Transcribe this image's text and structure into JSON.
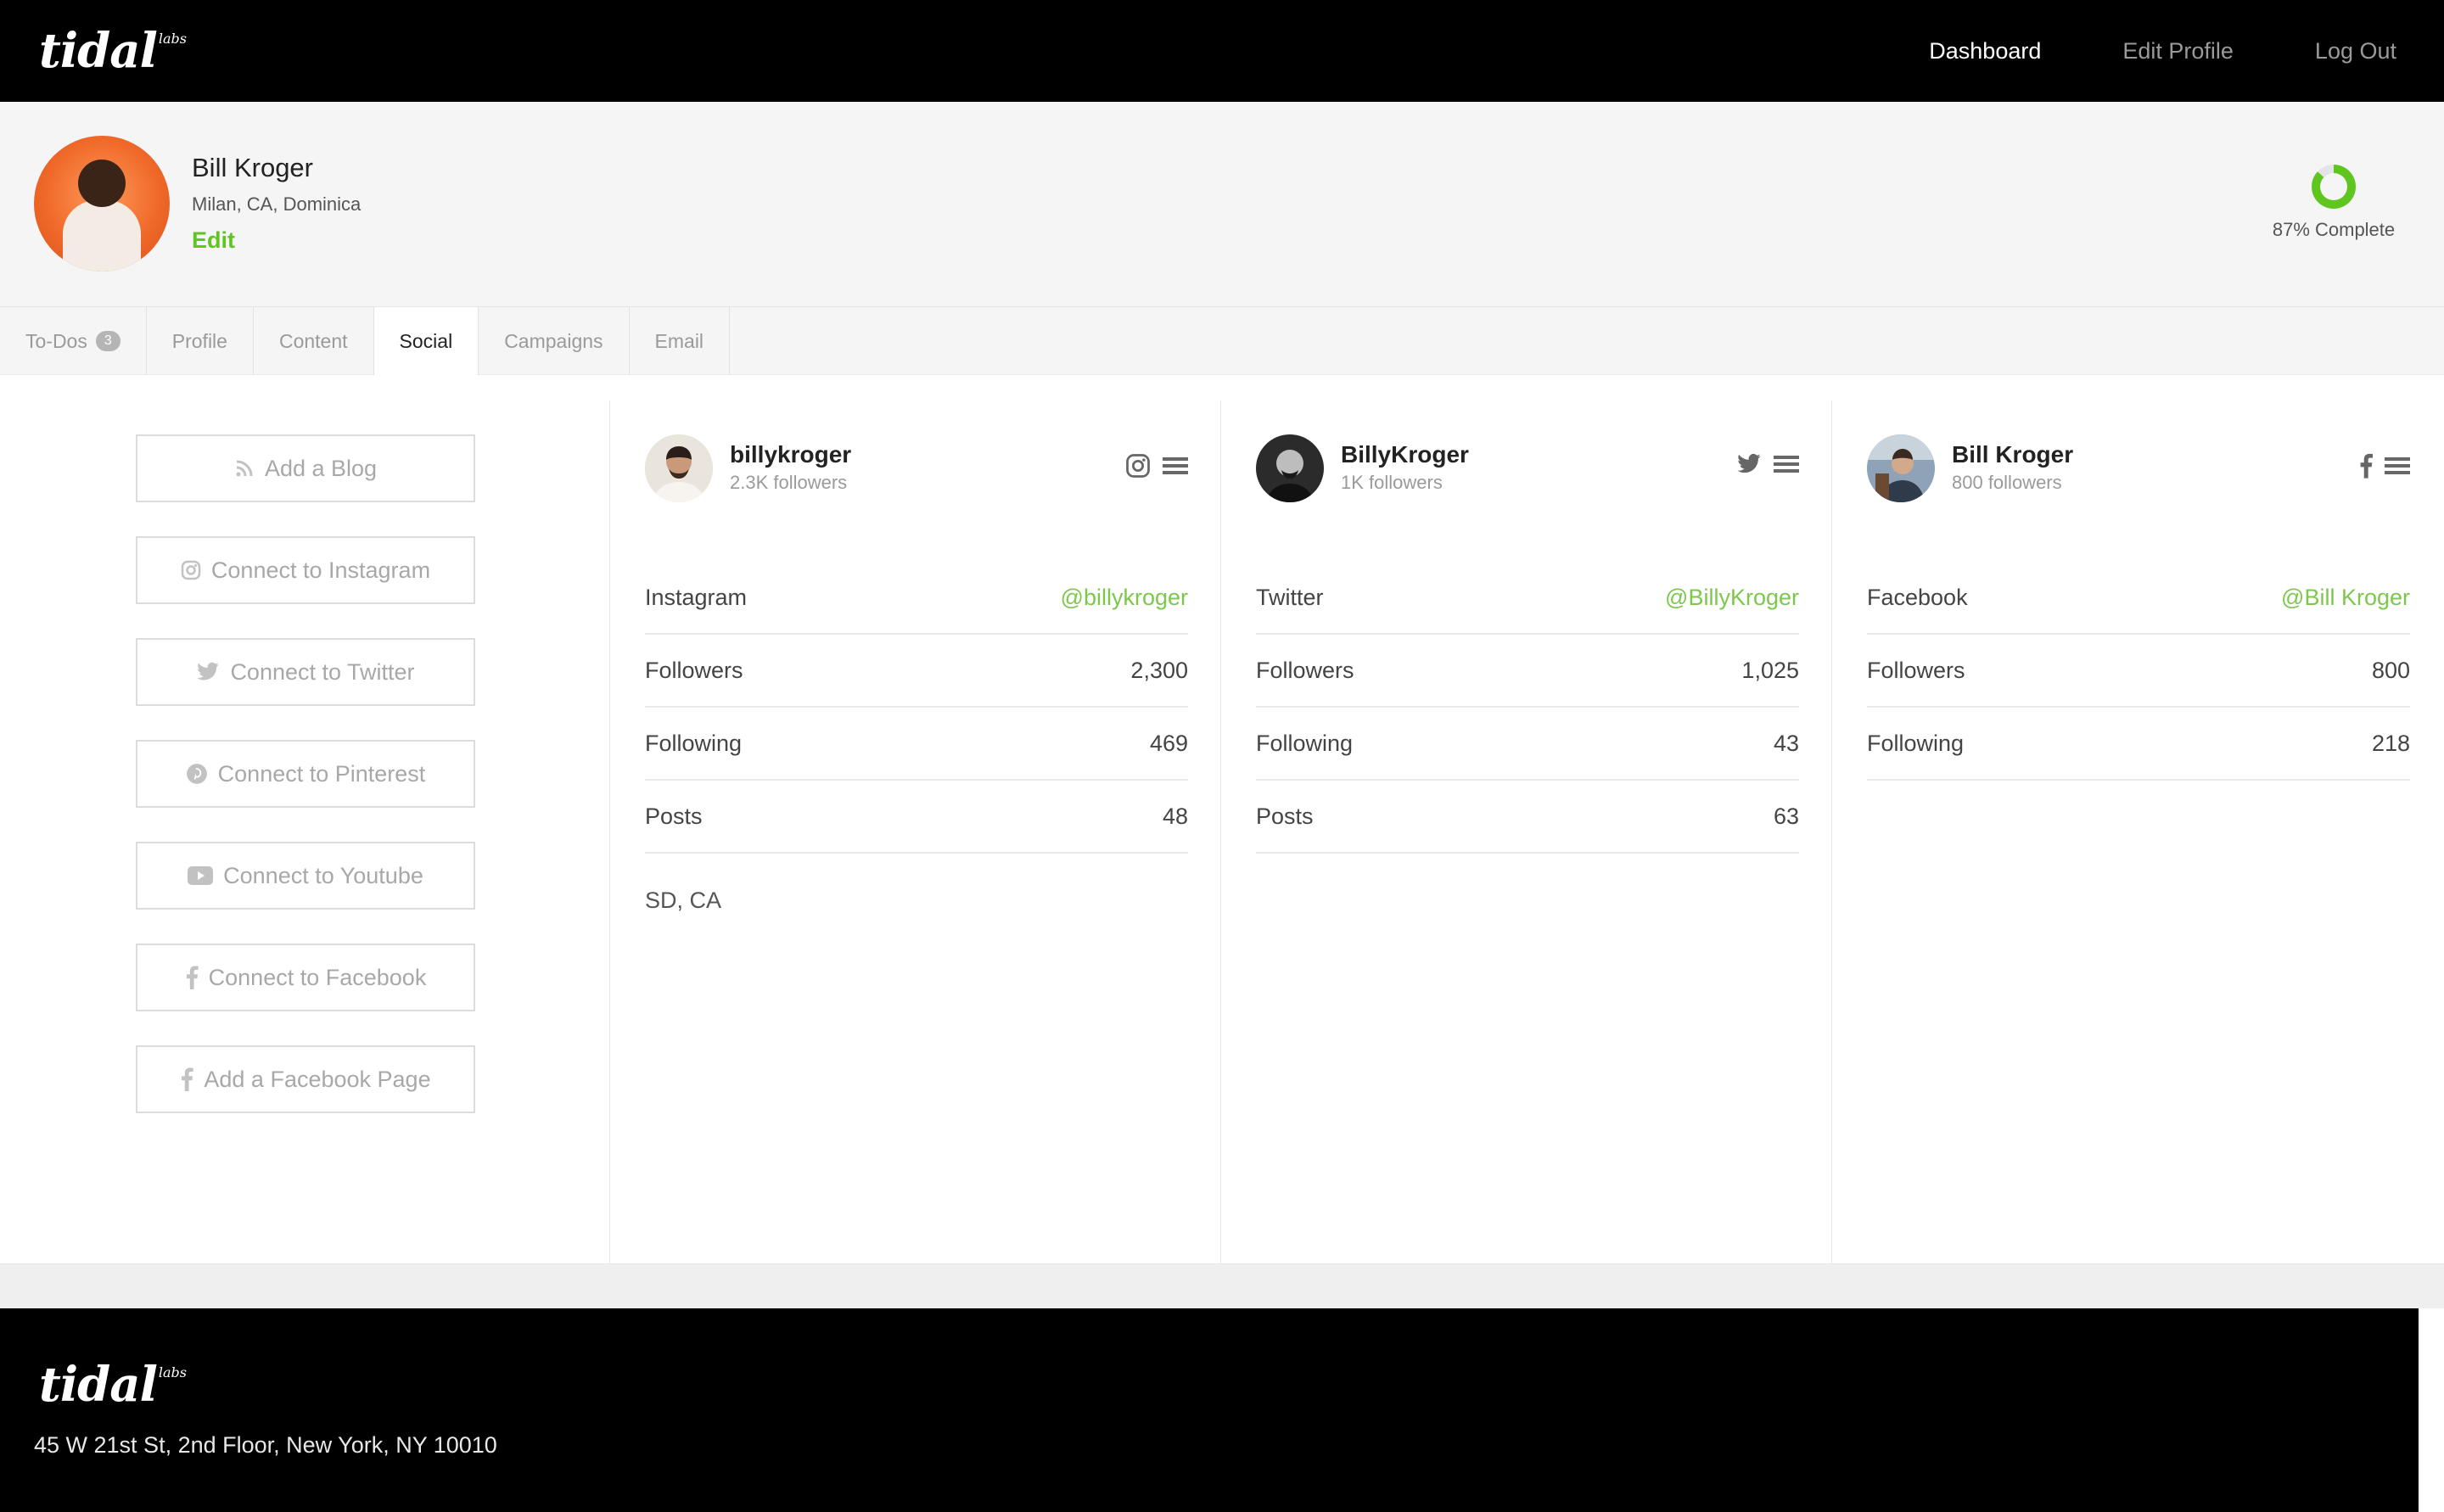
{
  "brand": {
    "name": "tidal",
    "suffix": "labs"
  },
  "nav": {
    "dashboard": "Dashboard",
    "edit_profile": "Edit Profile",
    "log_out": "Log Out"
  },
  "profile": {
    "name": "Bill Kroger",
    "location": "Milan, CA, Dominica",
    "edit_label": "Edit",
    "completion_label": "87% Complete",
    "completion_fraction": 0.87
  },
  "tabs": [
    {
      "label": "To-Dos",
      "badge": "3"
    },
    {
      "label": "Profile"
    },
    {
      "label": "Content"
    },
    {
      "label": "Social",
      "active": true
    },
    {
      "label": "Campaigns"
    },
    {
      "label": "Email"
    }
  ],
  "connect_buttons": [
    {
      "label": "Add a Blog",
      "icon": "rss-icon"
    },
    {
      "label": "Connect to Instagram",
      "icon": "instagram-icon"
    },
    {
      "label": "Connect to Twitter",
      "icon": "twitter-icon"
    },
    {
      "label": "Connect to Pinterest",
      "icon": "pinterest-icon"
    },
    {
      "label": "Connect to Youtube",
      "icon": "youtube-icon"
    },
    {
      "label": "Connect to Facebook",
      "icon": "facebook-icon"
    },
    {
      "label": "Add a Facebook Page",
      "icon": "facebook-icon"
    }
  ],
  "accounts": [
    {
      "network": "instagram",
      "icon": "instagram-icon",
      "username": "billykroger",
      "followers_summary": "2.3K followers",
      "rows": [
        {
          "label": "Instagram",
          "value": "@billykroger"
        },
        {
          "label": "Followers",
          "value": "2,300"
        },
        {
          "label": "Following",
          "value": "469"
        },
        {
          "label": "Posts",
          "value": "48"
        }
      ],
      "location": "SD, CA"
    },
    {
      "network": "twitter",
      "icon": "twitter-icon",
      "username": "BillyKroger",
      "followers_summary": "1K followers",
      "rows": [
        {
          "label": "Twitter",
          "value": "@BillyKroger"
        },
        {
          "label": "Followers",
          "value": "1,025"
        },
        {
          "label": "Following",
          "value": "43"
        },
        {
          "label": "Posts",
          "value": "63"
        }
      ]
    },
    {
      "network": "facebook",
      "icon": "facebook-icon",
      "username": "Bill Kroger",
      "followers_summary": "800 followers",
      "rows": [
        {
          "label": "Facebook",
          "value": "@Bill Kroger"
        },
        {
          "label": "Followers",
          "value": "800"
        },
        {
          "label": "Following",
          "value": "218"
        }
      ]
    }
  ],
  "footer": {
    "address": "45 W 21st St, 2nd Floor, New York, NY 10010"
  },
  "colors": {
    "accent": "#5fc51f",
    "link": "#7cc84a",
    "nav_bg": "#000000"
  }
}
